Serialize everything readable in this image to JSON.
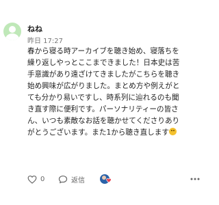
{
  "comment": {
    "username": "ねね",
    "timestamp": "昨日 17:27",
    "body_lines": [
      "春から寝る時アーカイブを聴き始め、寝落ちを",
      "繰り返しやっとここまできました！日本史は苦",
      "手意識があり遠ざけてきましたがこちらを聴き",
      "始め興味が広がりました。まとめ方や例えがと",
      "ても分かり易いですし、時系列に辿れるのも聞",
      "き直す際に便利です。パーソナリティーの皆さ",
      "ん、いつも素敵なお話を聴かせてくださりあり",
      "がとうございます。また1から聴き直します"
    ],
    "emoji": "smiling-face-emoji",
    "avatar_icon": "default-user-icon"
  },
  "actions": {
    "like_count": "0",
    "reply_label": "返信"
  },
  "colors": {
    "avatar_bg": "#bfe8b8",
    "creator_badge": "#2a62a8",
    "heart": "#e8404f",
    "muted_text": "#777777"
  }
}
